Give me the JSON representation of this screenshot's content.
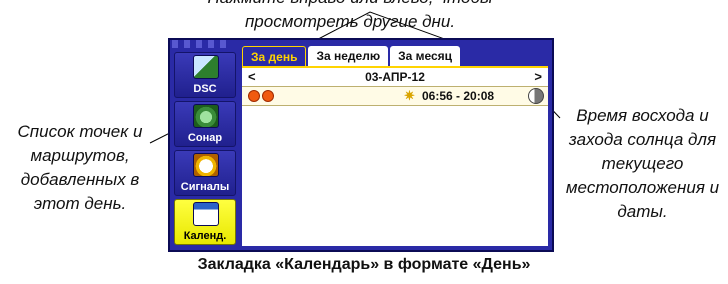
{
  "callouts": {
    "top": "Нажмите вправо или влево, чтобы просмотреть другие дни.",
    "left": "Список точек и маршрутов, добавленных в этот день.",
    "right": "Время восхода и захода солнца для текущего местоположения и даты."
  },
  "caption": "Закладка «Календарь» в формате «День»",
  "sidebar": {
    "items": [
      {
        "label": "DSC",
        "icon": "dsc-icon"
      },
      {
        "label": "Сонар",
        "icon": "sonar-icon"
      },
      {
        "label": "Сигналы",
        "icon": "alarm-clock-icon"
      },
      {
        "label": "Календ.",
        "icon": "calendar-icon"
      }
    ]
  },
  "tabs": [
    "За день",
    "За неделю",
    "За месяц"
  ],
  "calendar": {
    "prev": "<",
    "next": ">",
    "date": "03-АПР-12",
    "sun_times": "06:56 - 20:08"
  },
  "colors": {
    "screen_bg": "#2a2aa6",
    "active_tab": "#ffd400",
    "active_item": "#ffff40"
  }
}
